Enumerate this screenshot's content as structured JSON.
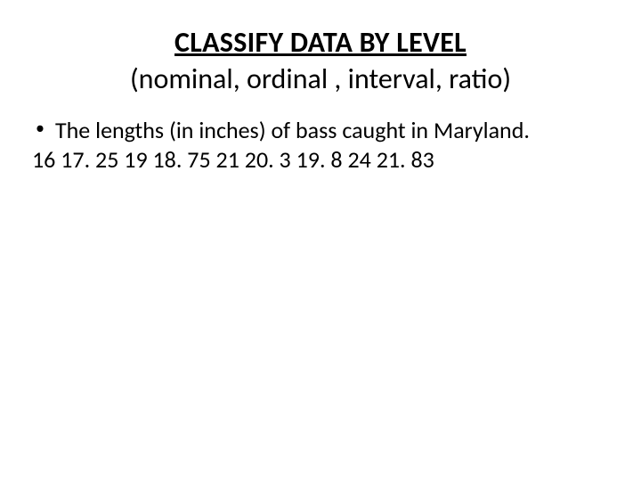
{
  "title": {
    "main": "CLASSIFY DATA BY LEVEL",
    "sub": "(nominal, ordinal , interval, ratio)"
  },
  "bullet": {
    "marker": "•",
    "text": "The lengths (in inches) of  bass caught in Maryland."
  },
  "data_values": "16   17. 25   19   18. 75   21   20. 3   19. 8   24   21. 83"
}
